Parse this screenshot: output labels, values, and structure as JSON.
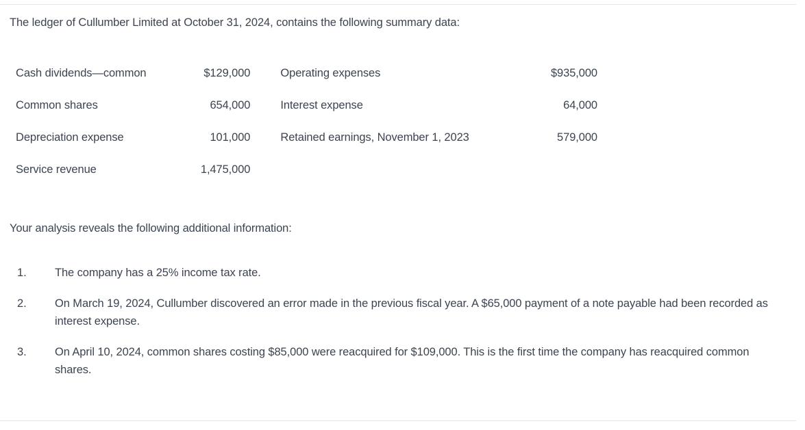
{
  "document": {
    "intro": "The ledger of Cullumber Limited at October 31, 2024, contains the following summary data:",
    "analysis_intro": "Your analysis reveals the following additional information:"
  },
  "summary_table": {
    "rows": [
      {
        "left_label": "Cash dividends—common",
        "left_amount": "$129,000",
        "right_label": "Operating expenses",
        "right_amount": "$935,000"
      },
      {
        "left_label": "Common shares",
        "left_amount": "654,000",
        "right_label": "Interest expense",
        "right_amount": "64,000"
      },
      {
        "left_label": "Depreciation expense",
        "left_amount": "101,000",
        "right_label": "Retained earnings, November 1, 2023",
        "right_amount": "579,000"
      },
      {
        "left_label": "Service revenue",
        "left_amount": "1,475,000",
        "right_label": "",
        "right_amount": ""
      }
    ]
  },
  "notes": [
    {
      "number": "1.",
      "text": "The company has a 25% income tax rate."
    },
    {
      "number": "2.",
      "text": "On March 19, 2024, Cullumber discovered an error made in the previous fiscal year. A $65,000 payment of a note payable had been recorded as interest expense."
    },
    {
      "number": "3.",
      "text": "On April 10, 2024, common shares costing $85,000 were reacquired for $109,000. This is the first time the company has reacquired common shares."
    }
  ],
  "colors": {
    "text": "#3c4451",
    "rule": "#e2e4e7",
    "background": "#ffffff"
  }
}
